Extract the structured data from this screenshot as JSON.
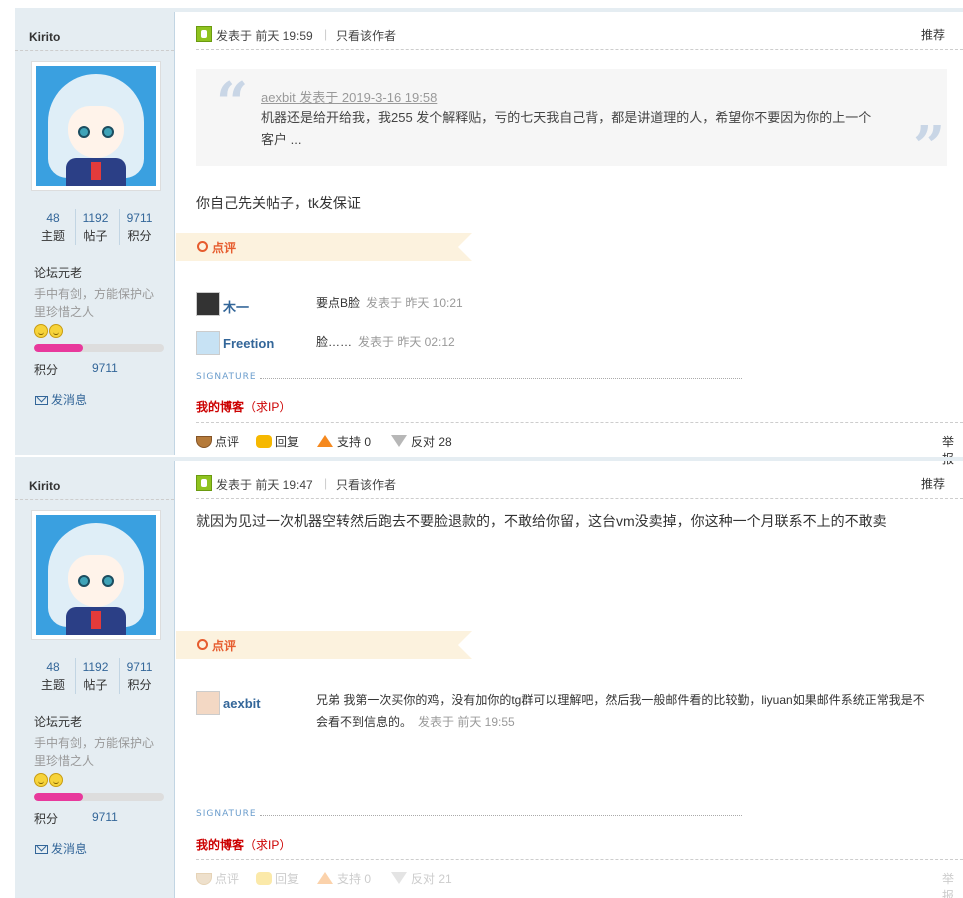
{
  "posts": [
    {
      "author": "Kirito",
      "stats": [
        {
          "num": "48",
          "label": "主题"
        },
        {
          "num": "1192",
          "label": "帖子"
        },
        {
          "num": "9711",
          "label": "积分"
        }
      ],
      "usergroup": "论坛元老",
      "custom_title": "手中有剑，方能保护心里珍惜之人",
      "score_label": "积分",
      "score_value": "9711",
      "progress": 0.38,
      "send_msg": "发消息",
      "post_time": "发表于 前天 19:59",
      "separator": "|",
      "only_author": "只看该作者",
      "recommend": "推荐",
      "quote": {
        "header": "aexbit 发表于 2019-3-16 19:58",
        "body": "机器还是给开给我，我255 发个解释贴，亏的七天我自己背，都是讲道理的人，希望你不要因为你的上一个客户 ..."
      },
      "content": "你自己先关帖子，tk发保证",
      "comment_header": "点评",
      "comments": [
        {
          "name": "木一",
          "text": "要点B脸",
          "time": "发表于 昨天 10:21"
        },
        {
          "name": "Freetion",
          "text": "脸……",
          "time": "发表于 昨天 02:12"
        }
      ],
      "signature_label": "SIGNATURE",
      "signature_link": "我的博客",
      "signature_sub": "（求IP）",
      "actions": {
        "comment": "点评",
        "reply": "回复",
        "support": "支持 0",
        "oppose": "反对 28",
        "report": "举报"
      }
    },
    {
      "author": "Kirito",
      "stats": [
        {
          "num": "48",
          "label": "主题"
        },
        {
          "num": "1192",
          "label": "帖子"
        },
        {
          "num": "9711",
          "label": "积分"
        }
      ],
      "usergroup": "论坛元老",
      "custom_title": "手中有剑，方能保护心里珍惜之人",
      "score_label": "积分",
      "score_value": "9711",
      "progress": 0.38,
      "send_msg": "发消息",
      "post_time": "发表于 前天 19:47",
      "separator": "|",
      "only_author": "只看该作者",
      "recommend": "推荐",
      "content": "就因为见过一次机器空转然后跑去不要脸退款的，不敢给你留，这台vm没卖掉，你这种一个月联系不上的不敢卖",
      "comment_header": "点评",
      "comments": [
        {
          "name": "aexbit",
          "text": "兄弟 我第一次买你的鸡，没有加你的tg群可以理解吧，然后我一般邮件看的比较勤，liyuan如果邮件系统正常我是不会看不到信息的。",
          "time": "发表于 前天 19:55"
        }
      ],
      "signature_label": "SIGNATURE",
      "signature_link": "我的博客",
      "signature_sub": "（求IP）",
      "actions": {
        "comment": "点评",
        "reply": "回复",
        "support": "支持 0",
        "oppose": "反对 21",
        "report": "举报"
      }
    }
  ]
}
